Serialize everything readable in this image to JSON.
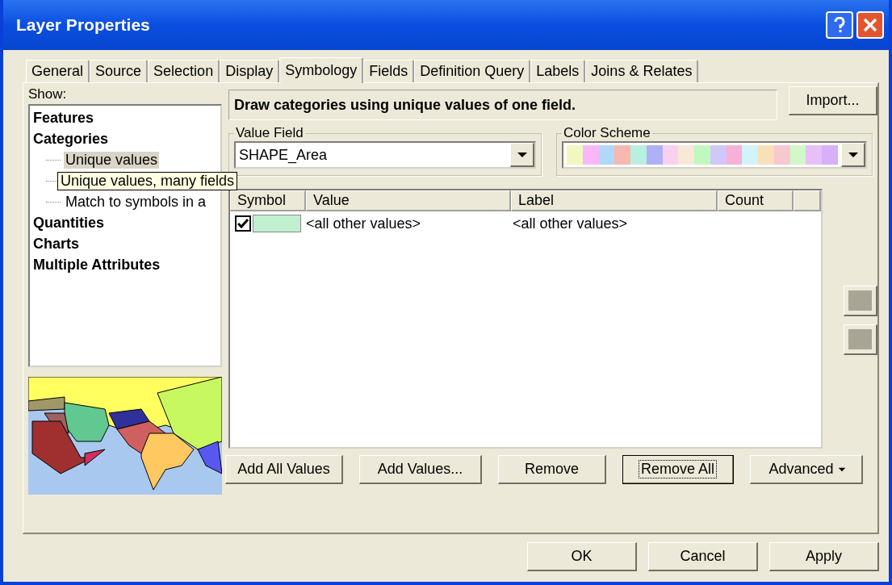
{
  "window": {
    "title": "Layer Properties"
  },
  "tabs": [
    {
      "label": "General",
      "selected": false
    },
    {
      "label": "Source",
      "selected": false
    },
    {
      "label": "Selection",
      "selected": false
    },
    {
      "label": "Display",
      "selected": false
    },
    {
      "label": "Symbology",
      "selected": true
    },
    {
      "label": "Fields",
      "selected": false
    },
    {
      "label": "Definition Query",
      "selected": false
    },
    {
      "label": "Labels",
      "selected": false
    },
    {
      "label": "Joins & Relates",
      "selected": false
    }
  ],
  "show": {
    "label": "Show:",
    "tree": [
      {
        "label": "Features",
        "selected": false
      },
      {
        "label": "Categories",
        "selected": false,
        "children": [
          {
            "label": "Unique values",
            "selected": true
          },
          {
            "label": "Match to symbols in a",
            "selected": false
          }
        ]
      },
      {
        "label": "Quantities",
        "selected": false
      },
      {
        "label": "Charts",
        "selected": false
      },
      {
        "label": "Multiple Attributes",
        "selected": false
      }
    ],
    "tooltip": "Unique values, many fields"
  },
  "description": "Draw categories using unique values of one field.",
  "import_button": "Import...",
  "value_field": {
    "label": "Value Field",
    "value": "SHAPE_Area"
  },
  "color_scheme": {
    "label": "Color Scheme",
    "swatches": [
      {
        "color": "#f0f8c0"
      },
      {
        "color": "#f8b8f8"
      },
      {
        "color": "#b0d8f8"
      },
      {
        "color": "#f8b8b0"
      },
      {
        "color": "#b8f0e0"
      },
      {
        "color": "#b0b0f8"
      },
      {
        "color": "#f8d0f0"
      },
      {
        "color": "#f8e8d8"
      },
      {
        "color": "#c0f8c0"
      },
      {
        "color": "#d0c8f8"
      },
      {
        "color": "#f8b0d8"
      },
      {
        "color": "#d0f4f8"
      },
      {
        "color": "#f8e0b8"
      },
      {
        "color": "#f8c8d0"
      },
      {
        "color": "#d0f8c8"
      },
      {
        "color": "#e8c0f8"
      },
      {
        "color": "#d8b0f8"
      }
    ]
  },
  "table": {
    "columns": [
      "Symbol",
      "Value",
      "Label",
      "Count"
    ],
    "rows": [
      {
        "checked": true,
        "color": "#c0f0d0",
        "value": "<all other values>",
        "label": "<all other values>"
      }
    ]
  },
  "action_buttons": [
    {
      "label": "Add All Values",
      "focused": false
    },
    {
      "label": "Add Values...",
      "focused": false
    },
    {
      "label": "Remove",
      "focused": false
    },
    {
      "label": "Remove All",
      "focused": true
    },
    {
      "label": "Advanced",
      "focused": false,
      "kind": "menu"
    }
  ],
  "dialog_buttons": [
    "OK",
    "Cancel",
    "Apply"
  ]
}
